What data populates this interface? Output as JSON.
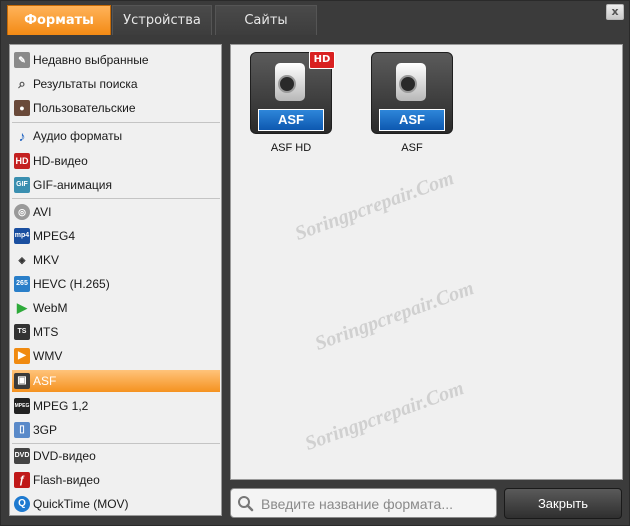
{
  "tabs": [
    {
      "label": "Форматы",
      "active": true
    },
    {
      "label": "Устройства",
      "active": false
    },
    {
      "label": "Сайты",
      "active": false
    }
  ],
  "close_glyph": "x",
  "categories": [
    {
      "label": "Недавно выбранные",
      "icon": "recent-icon"
    },
    {
      "label": "Результаты поиска",
      "icon": "search-results-icon"
    },
    {
      "label": "Пользовательские",
      "icon": "user-icon"
    },
    {
      "label": "Аудио форматы",
      "icon": "audio-note-icon"
    },
    {
      "label": "HD-видео",
      "icon": "hd-icon",
      "icon_text": "HD"
    },
    {
      "label": "GIF-анимация",
      "icon": "gif-icon",
      "icon_text": "GIF"
    },
    {
      "label": "AVI",
      "icon": "avi-icon"
    },
    {
      "label": "MPEG4",
      "icon": "mp4-icon",
      "icon_text": "mp4"
    },
    {
      "label": "MKV",
      "icon": "mkv-icon"
    },
    {
      "label": "HEVC (H.265)",
      "icon": "hevc-icon",
      "icon_text": "265"
    },
    {
      "label": "WebM",
      "icon": "webm-play-icon"
    },
    {
      "label": "MTS",
      "icon": "mts-icon"
    },
    {
      "label": "WMV",
      "icon": "wmv-icon"
    },
    {
      "label": "ASF",
      "icon": "asf-icon",
      "selected": true
    },
    {
      "label": "MPEG 1,2",
      "icon": "mpeg-icon",
      "icon_text": "MPEG"
    },
    {
      "label": "3GP",
      "icon": "3gp-phone-icon"
    },
    {
      "label": "DVD-видео",
      "icon": "dvd-icon"
    },
    {
      "label": "Flash-видео",
      "icon": "flash-icon"
    },
    {
      "label": "QuickTime (MOV)",
      "icon": "quicktime-icon"
    }
  ],
  "formats": [
    {
      "badge": "ASF",
      "hd_label": "HD",
      "caption": "ASF HD"
    },
    {
      "badge": "ASF",
      "caption": "ASF"
    }
  ],
  "search": {
    "placeholder": "Введите название формата..."
  },
  "close_button": "Закрыть",
  "watermark": "Soringpcrepair.Com",
  "colors": {
    "accent": "#f59220",
    "badge_blue": "#0d58b0",
    "hd_red": "#d92020"
  }
}
